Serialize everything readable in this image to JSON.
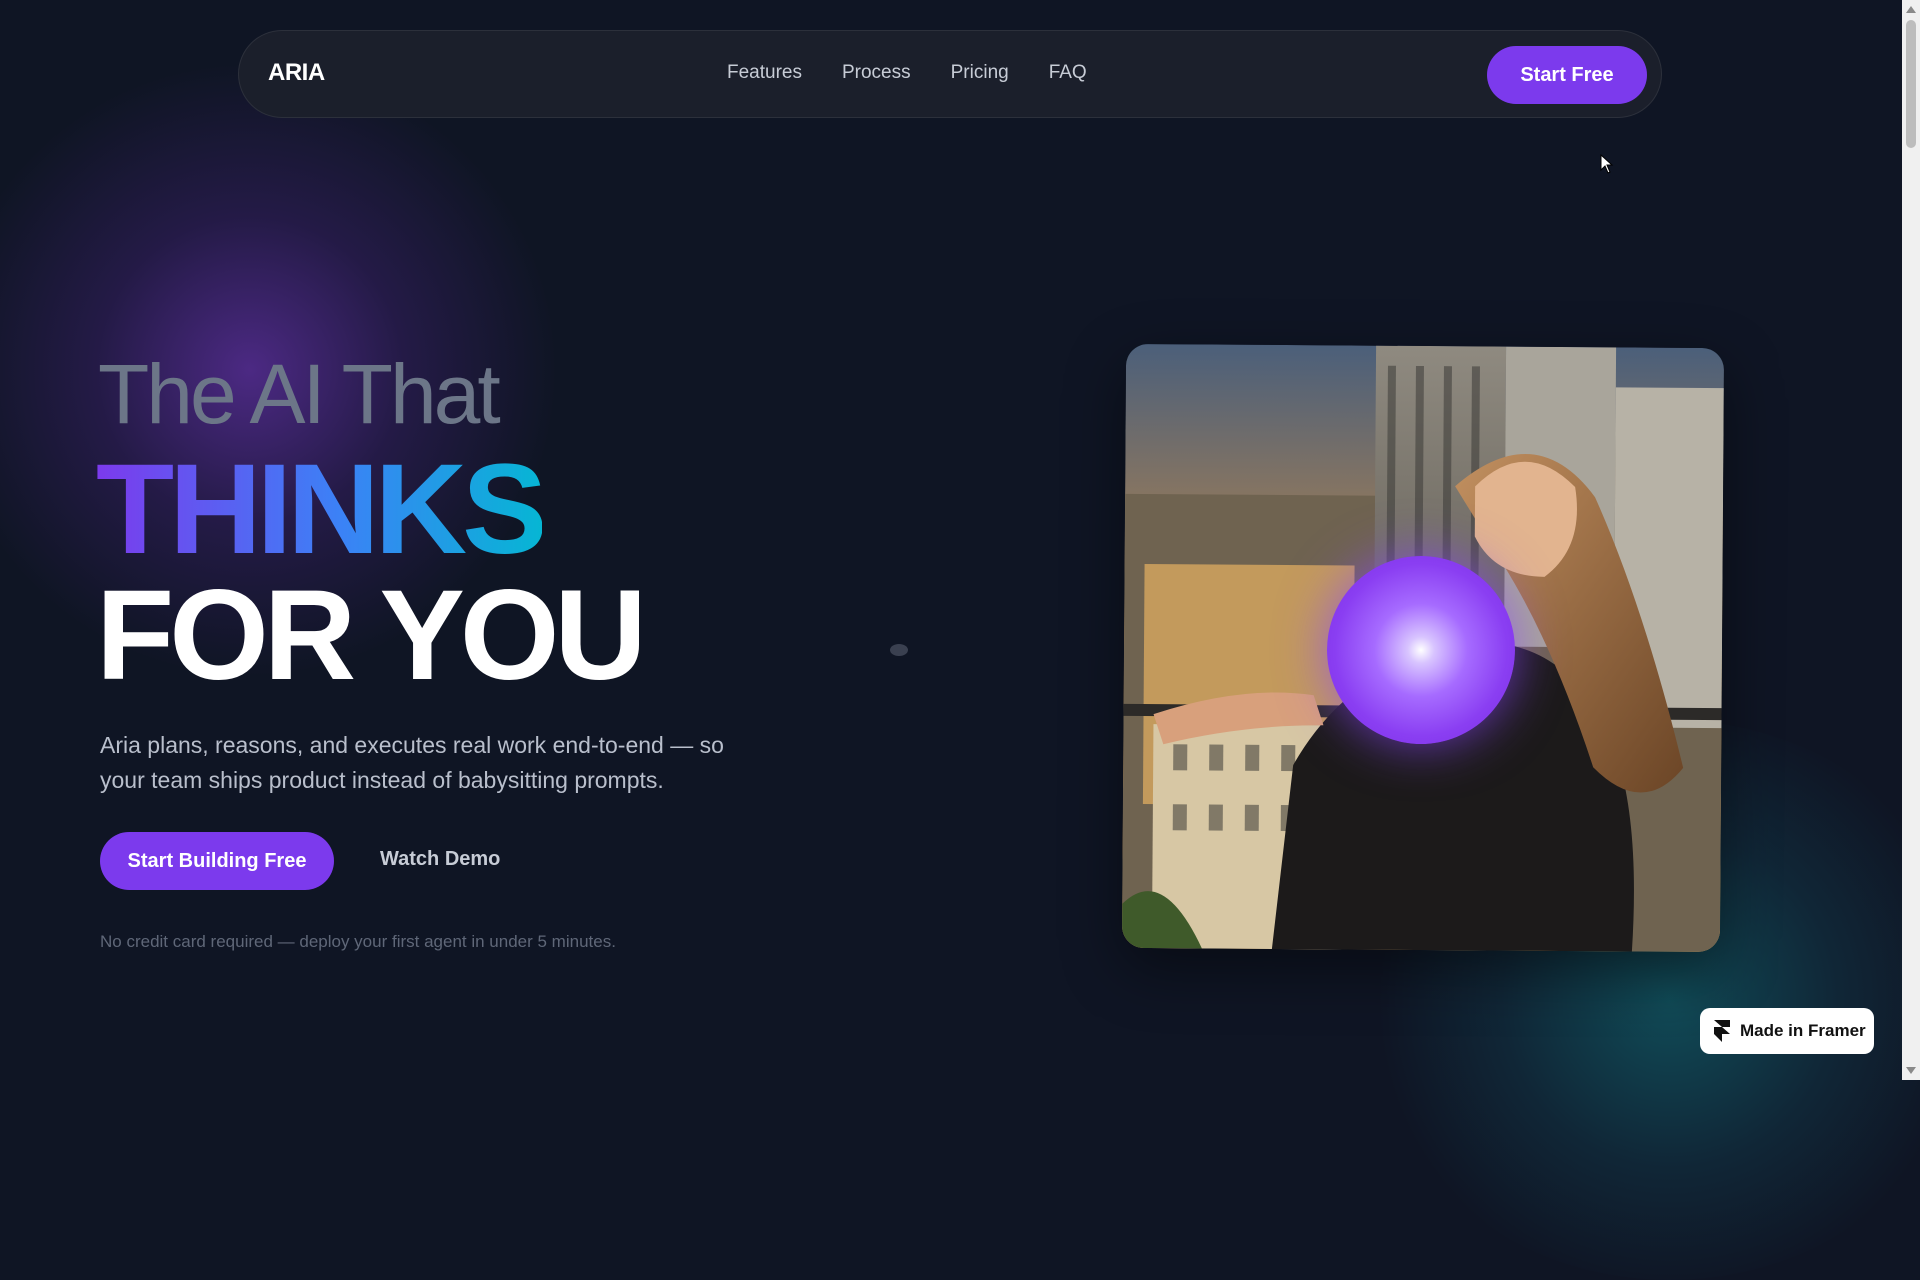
{
  "nav": {
    "logo": "ARIA",
    "links": [
      "Features",
      "Process",
      "Pricing",
      "FAQ"
    ],
    "cta": "Start Free"
  },
  "hero": {
    "line1": "The AI That",
    "line2": "THINKS",
    "line3": "FOR YOU",
    "subtitle": "Aria plans, reasons, and executes real work end-to-end — so your team ships product instead of babysitting prompts.",
    "primary_cta": "Start Building Free",
    "secondary_cta": "Watch Demo",
    "note": "No credit card required — deploy your first agent in under 5 minutes."
  },
  "badge": {
    "label": "Made in Framer",
    "icon": "framer-icon"
  },
  "colors": {
    "background": "#0f1524",
    "accent": "#7c3aed",
    "gradient": [
      "#7c3aed",
      "#3b82f6",
      "#06b6d4"
    ]
  }
}
